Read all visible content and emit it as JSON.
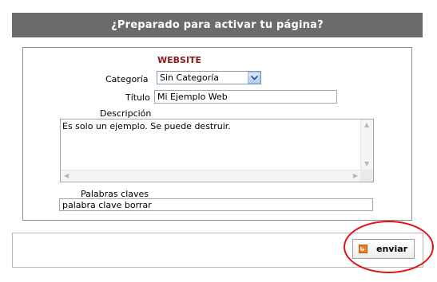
{
  "header": {
    "title": "¿Preparado para activar tu página?"
  },
  "form": {
    "section_title": "WEBSITE",
    "category": {
      "label": "Categoría",
      "value": "Sin Categoría"
    },
    "title": {
      "label": "Título",
      "value": "Mi Ejemplo Web"
    },
    "description": {
      "label": "Descripción",
      "value": "Es solo un ejemplo. Se puede destruir."
    },
    "keywords": {
      "label": "Palabras claves",
      "value": "palabra clave borrar"
    }
  },
  "footer": {
    "submit_label": "enviar"
  },
  "colors": {
    "header_bg": "#6b6b6b",
    "section_title": "#8b1a1a",
    "highlight": "#e0141a",
    "icon": "#e87a2a"
  }
}
